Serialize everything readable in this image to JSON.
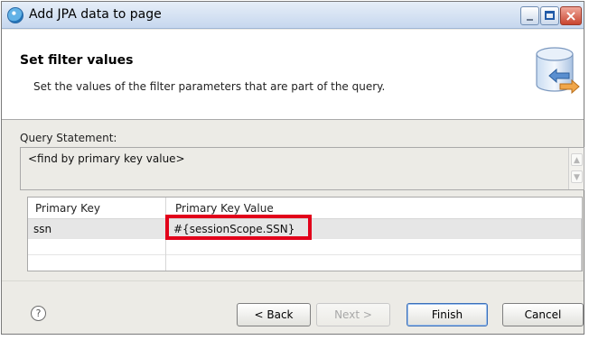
{
  "window": {
    "title": "Add JPA data to page"
  },
  "banner": {
    "title": "Set filter values",
    "description": "Set the values of the filter parameters that are part of the query.",
    "icon": "database-exchange-icon"
  },
  "query": {
    "label": "Query Statement:",
    "value": "<find by primary key value>"
  },
  "table": {
    "columns": [
      "Primary Key",
      "Primary Key Value"
    ],
    "rows": [
      {
        "key": "ssn",
        "value": "#{sessionScope.SSN}"
      }
    ],
    "highlight_color": "#e2001a"
  },
  "buttons": {
    "help": "?",
    "back": "< Back",
    "next": "Next >",
    "finish": "Finish",
    "cancel": "Cancel"
  },
  "colors": {
    "dialog_bg": "#ecebe6",
    "titlebar": "#c6d7ee"
  }
}
